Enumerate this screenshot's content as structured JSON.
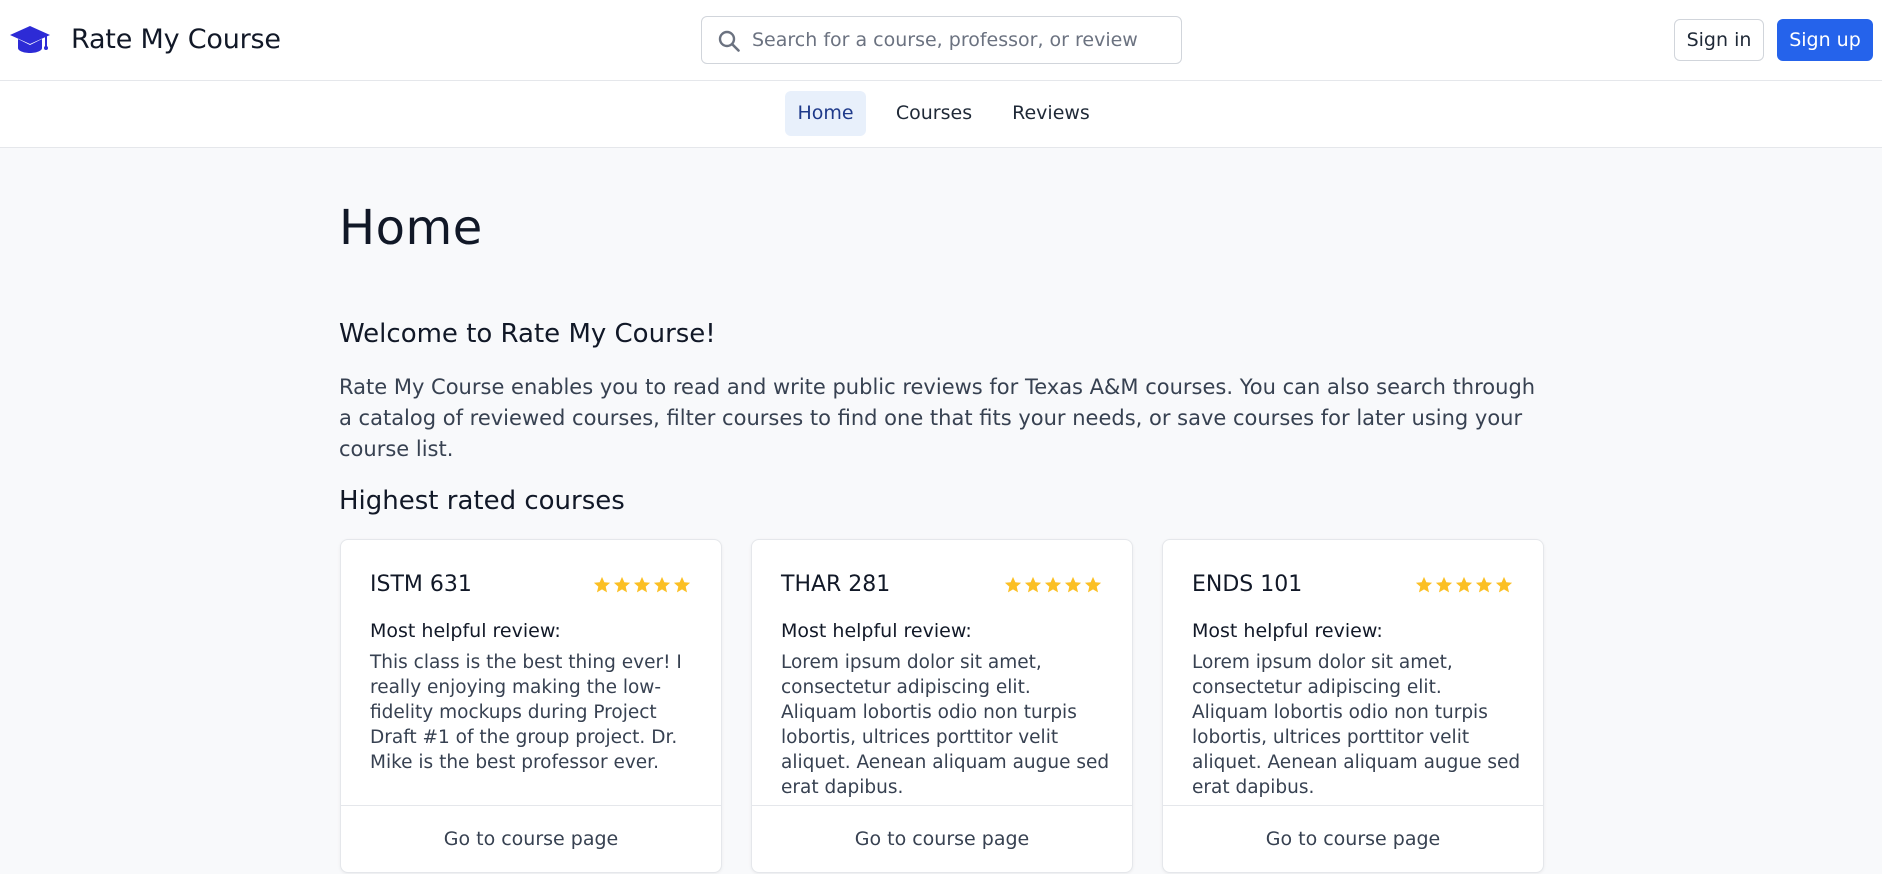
{
  "header": {
    "brand_name": "Rate My Course",
    "brand_icon": "graduation-cap-icon",
    "brand_color": "#2d2bd6",
    "search_placeholder": "Search for a course, professor, or review",
    "signin_label": "Sign in",
    "signup_label": "Sign up",
    "accent_color": "#2563eb"
  },
  "nav": {
    "items": [
      {
        "label": "Home",
        "active": true
      },
      {
        "label": "Courses",
        "active": false
      },
      {
        "label": "Reviews",
        "active": false
      }
    ]
  },
  "main": {
    "page_title": "Home",
    "welcome_title": "Welcome to Rate My Course!",
    "intro_text": "Rate My Course enables you to read and write public reviews for Texas A&M courses. You can also search through a catalog of reviewed courses, filter courses to find one that fits your needs, or save courses for later using your course list.",
    "highest_rated_title": "Highest rated courses"
  },
  "courses": [
    {
      "code": "ISTM 631",
      "rating": 5,
      "helpful_label": "Most helpful review:",
      "review": "This class is the best thing ever! I really enjoying making the low-fidelity mockups during Project Draft #1 of the group project. Dr. Mike is the best professor ever.",
      "link_label": "Go to course page"
    },
    {
      "code": "THAR 281",
      "rating": 5,
      "helpful_label": "Most helpful review:",
      "review": "Lorem ipsum dolor sit amet, consectetur adipiscing elit. Aliquam lobortis odio non turpis lobortis, ultrices porttitor velit aliquet. Aenean aliquam augue sed erat dapibus.",
      "link_label": "Go to course page"
    },
    {
      "code": "ENDS 101",
      "rating": 5,
      "helpful_label": "Most helpful review:",
      "review": "Lorem ipsum dolor sit amet, consectetur adipiscing elit. Aliquam lobortis odio non turpis lobortis, ultrices porttitor velit aliquet. Aenean aliquam augue sed erat dapibus.",
      "link_label": "Go to course page"
    }
  ],
  "star_color": "#fbbf24"
}
